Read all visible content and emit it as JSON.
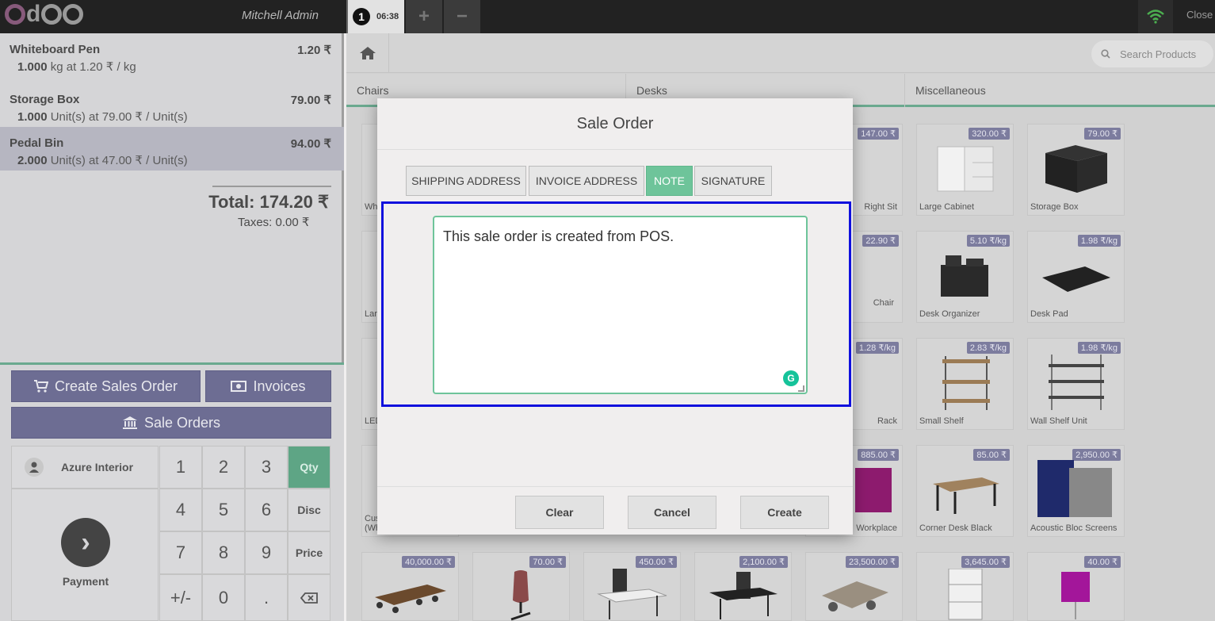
{
  "topbar": {
    "username": "Mitchell Admin",
    "order_number": "1",
    "order_time": "06:38",
    "add_label": "+",
    "remove_label": "−",
    "close_label": "Close"
  },
  "order": {
    "lines": [
      {
        "name": "Whiteboard Pen",
        "price": "1.20 ₹",
        "qty": "1.000",
        "detail": "kg at 1.20 ₹ / kg"
      },
      {
        "name": "Storage Box",
        "price": "79.00 ₹",
        "qty": "1.000",
        "detail": "Unit(s) at 79.00 ₹ / Unit(s)"
      },
      {
        "name": "Pedal Bin",
        "price": "94.00 ₹",
        "qty": "2.000",
        "detail": "Unit(s) at 47.00 ₹ / Unit(s)"
      }
    ],
    "total": "Total: 174.20 ₹",
    "taxes": "Taxes: 0.00 ₹"
  },
  "actions": {
    "create_sales_order": "Create Sales Order",
    "invoices": "Invoices",
    "sale_orders": "Sale Orders"
  },
  "numpad": {
    "customer": "Azure Interior",
    "payment": "Payment",
    "keys": [
      "1",
      "2",
      "3",
      "4",
      "5",
      "6",
      "7",
      "8",
      "9",
      "+/-",
      "0",
      "."
    ],
    "modes": [
      "Qty",
      "Disc",
      "Price"
    ]
  },
  "products_header": {
    "search_placeholder": "Search Products",
    "categories": [
      "Chairs",
      "Desks",
      "Miscellaneous"
    ]
  },
  "products": [
    {
      "name": "Whi",
      "price": ""
    },
    {
      "name": "Right Sit",
      "price": "147.00 ₹"
    },
    {
      "name": "Large Cabinet",
      "price": "320.00 ₹"
    },
    {
      "name": "Storage Box",
      "price": "79.00 ₹"
    },
    {
      "name": "Lar",
      "price": ""
    },
    {
      "name": "Chair",
      "price": "22.90 ₹"
    },
    {
      "name": "Desk Organizer",
      "price": "5.10 ₹/kg"
    },
    {
      "name": "Desk Pad",
      "price": "1.98 ₹/kg"
    },
    {
      "name": "LED",
      "price": ""
    },
    {
      "name": "Rack",
      "price": "1.28 ₹/kg"
    },
    {
      "name": "Small Shelf",
      "price": "2.83 ₹/kg"
    },
    {
      "name": "Wall Shelf Unit",
      "price": "1.98 ₹/kg"
    },
    {
      "name": "Cus (Wh",
      "price": ""
    },
    {
      "name": "Workplace",
      "price": "885.00 ₹"
    },
    {
      "name": "Corner Desk Black",
      "price": "85.00 ₹"
    },
    {
      "name": "Acoustic Bloc Screens",
      "price": "2,950.00 ₹"
    },
    {
      "name": "",
      "price": "40,000.00 ₹"
    },
    {
      "name": "",
      "price": "70.00 ₹"
    },
    {
      "name": "",
      "price": "450.00 ₹"
    },
    {
      "name": "",
      "price": "2,100.00 ₹"
    },
    {
      "name": "",
      "price": "23,500.00 ₹"
    },
    {
      "name": "",
      "price": "3,645.00 ₹"
    },
    {
      "name": "",
      "price": "40.00 ₹"
    }
  ],
  "modal": {
    "title": "Sale Order",
    "tabs": [
      "SHIPPING ADDRESS",
      "INVOICE ADDRESS",
      "NOTE",
      "SIGNATURE"
    ],
    "active_tab": "NOTE",
    "note_text": "This sale order is created from POS.",
    "buttons": {
      "clear": "Clear",
      "cancel": "Cancel",
      "create": "Create"
    }
  },
  "colors": {
    "accent_green": "#6ec49a",
    "button_purple": "#6d6d93",
    "highlight_blue": "#1010dd",
    "logo_purple": "#875a7b"
  }
}
